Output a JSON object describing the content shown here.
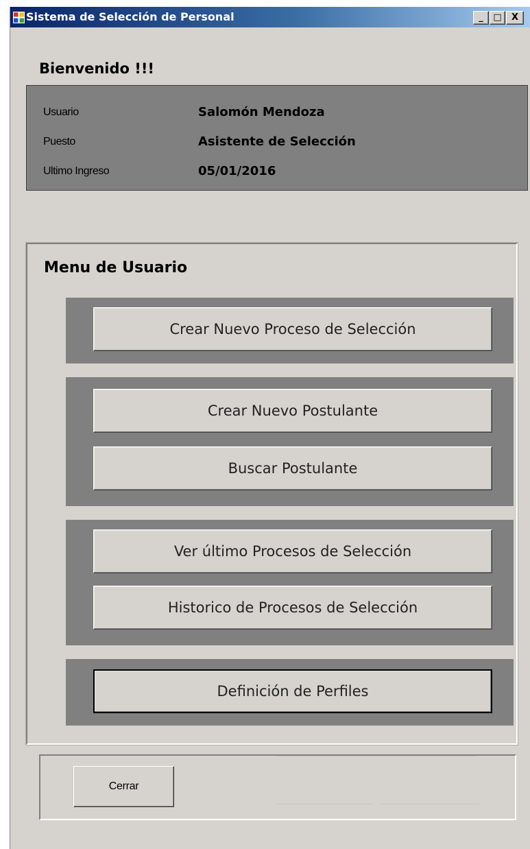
{
  "window": {
    "title": "Sistema de Selección de Personal",
    "controls": {
      "minimize": "_",
      "maximize": "□",
      "close": "X"
    }
  },
  "welcome": "Bienvenido !!!",
  "user_info": [
    {
      "label": "Usuario",
      "value": "Salomón Mendoza"
    },
    {
      "label": "Puesto",
      "value": "Asistente de Selección"
    },
    {
      "label": "Ultimo Ingreso",
      "value": "05/01/2016"
    }
  ],
  "menu": {
    "title": "Menu de Usuario",
    "buttons": [
      "Crear Nuevo Proceso de Selección",
      "Crear Nuevo Postulante",
      "Buscar Postulante",
      "Ver último Procesos de Selección",
      "Historico de Procesos de Selección",
      "Definición de Perfiles"
    ]
  },
  "footer": {
    "close_label": "Cerrar"
  },
  "colors": {
    "titlebar_start": "#0a246a",
    "titlebar_end": "#a6caf0",
    "window_bg": "#d6d3ce",
    "panel_bg": "#808080"
  }
}
